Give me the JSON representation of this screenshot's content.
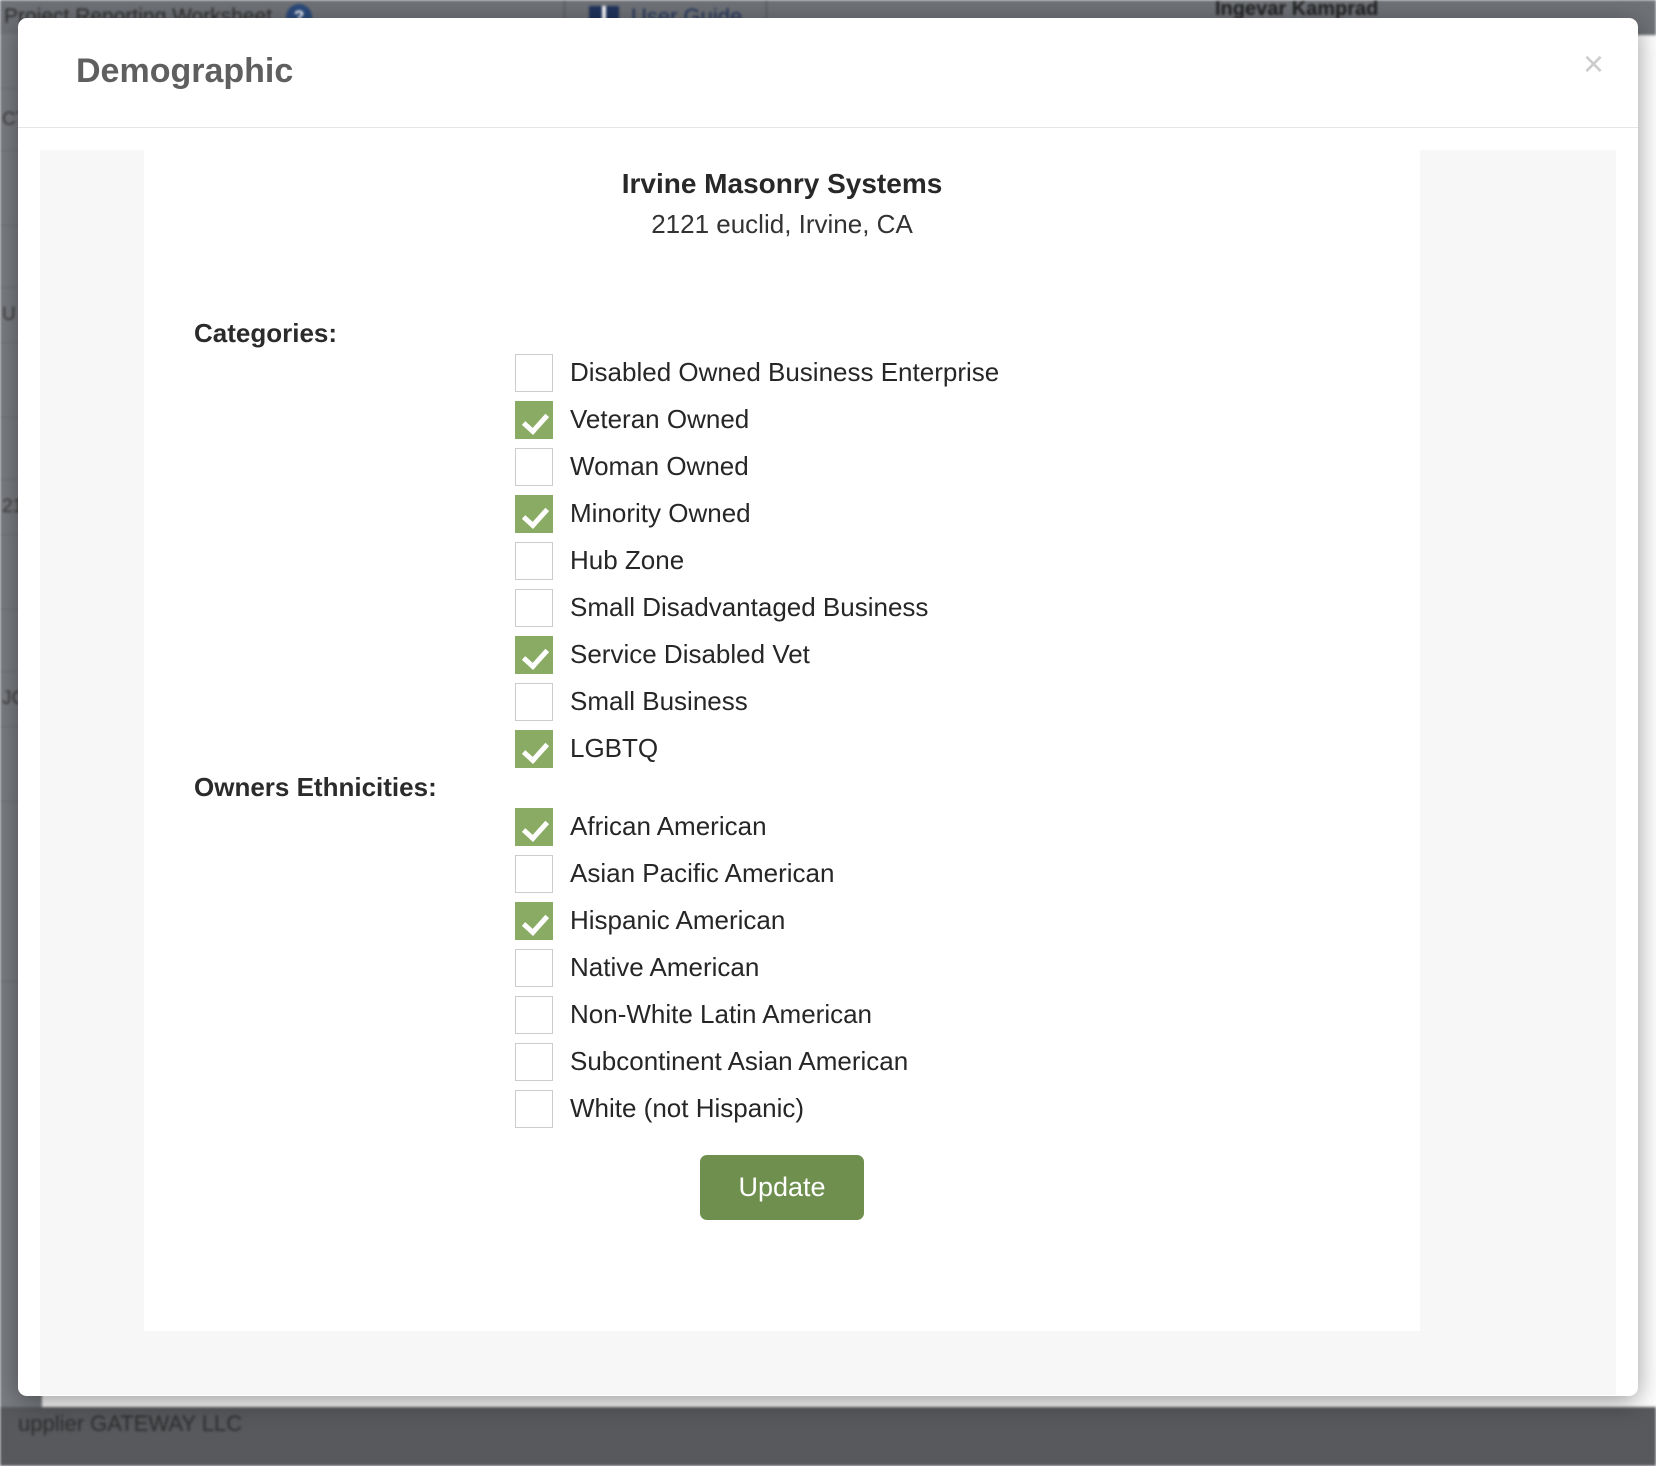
{
  "background": {
    "worksheet_title": "Project Reporting Worksheet",
    "help_icon": "question-mark-circle-icon",
    "user_guide_label": "User Guide",
    "user_guide_icon": "book-icon",
    "user_name": "Ingevar Kamprad",
    "footer_text": "upplier GATEWAY LLC",
    "table_row_fragments": [
      "",
      "CT",
      "",
      "",
      "U",
      "",
      "",
      "21",
      "",
      "",
      "JC",
      "",
      ""
    ]
  },
  "modal": {
    "title": "Demographic",
    "close_label": "×",
    "close_icon": "close-icon",
    "company": {
      "name": "Irvine Masonry Systems",
      "address": "2121 euclid, Irvine, CA"
    },
    "categories": {
      "label": "Categories:",
      "items": [
        {
          "label": "Disabled Owned Business Enterprise",
          "checked": false
        },
        {
          "label": "Veteran Owned",
          "checked": true
        },
        {
          "label": "Woman Owned",
          "checked": false
        },
        {
          "label": "Minority Owned",
          "checked": true
        },
        {
          "label": "Hub Zone",
          "checked": false
        },
        {
          "label": "Small Disadvantaged Business",
          "checked": false
        },
        {
          "label": "Service Disabled Vet",
          "checked": true
        },
        {
          "label": "Small Business",
          "checked": false
        },
        {
          "label": "LGBTQ",
          "checked": true
        }
      ]
    },
    "ethnicities": {
      "label": "Owners Ethnicities:",
      "items": [
        {
          "label": "African American",
          "checked": true
        },
        {
          "label": "Asian Pacific American",
          "checked": false
        },
        {
          "label": "Hispanic American",
          "checked": true
        },
        {
          "label": "Native American",
          "checked": false
        },
        {
          "label": "Non-White Latin American",
          "checked": false
        },
        {
          "label": "Subcontinent Asian American",
          "checked": false
        },
        {
          "label": "White (not Hispanic)",
          "checked": false
        }
      ]
    },
    "update_label": "Update"
  },
  "colors": {
    "checkbox_checked": "#8aab63",
    "checkbox_border": "#cccccc",
    "update_button": "#6e8f4e",
    "modal_title": "#5f5f5f",
    "close_icon": "#cccccc",
    "panel_shade": "#f7f7f7"
  }
}
